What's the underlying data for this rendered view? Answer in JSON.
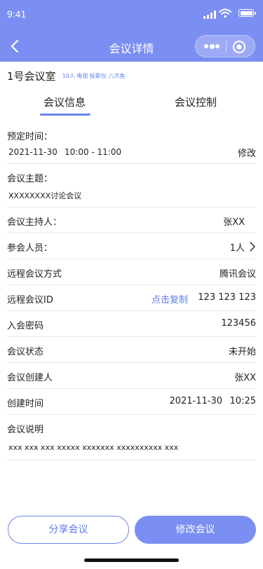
{
  "status_bar": {
    "time": "9:41"
  },
  "navbar": {
    "title": "会议详情"
  },
  "room": {
    "name": "1号会议室",
    "tags": "10人 电视 投影仪 八爪鱼"
  },
  "tabs": [
    {
      "label": "会议信息",
      "active": true
    },
    {
      "label": "会议控制",
      "active": false
    }
  ],
  "schedule": {
    "label": "预定时间：",
    "date": "2021-11-30",
    "time_range": "10:00 - 11:00",
    "edit_label": "修改"
  },
  "topic": {
    "label": "会议主题：",
    "value": "XXXXXXXX讨论会议"
  },
  "host": {
    "label": "会议主持人：",
    "value": "张XX"
  },
  "participants": {
    "label": "参会人员：",
    "value": "1人"
  },
  "remote_method": {
    "label": "远程会议方式",
    "value": "腾讯会议"
  },
  "remote_id": {
    "label": "远程会议ID",
    "copy_label": "点击复制",
    "value": "123 123 123"
  },
  "password": {
    "label": "入会密码",
    "value": "123456"
  },
  "meeting_status": {
    "label": "会议状态",
    "value": "未开始"
  },
  "creator": {
    "label": "会议创建人",
    "value": "张XX"
  },
  "created_time": {
    "label": "创建时间",
    "date": "2021-11-30",
    "time": "10:25"
  },
  "description": {
    "label": "会议说明",
    "value": "xxx xxx xxx xxxxx xxxxxxx xxxxxxxxxx xxx"
  },
  "actions": {
    "share_label": "分享会议",
    "edit_label": "修改会议"
  },
  "colors": {
    "primary": "#7b8ef2",
    "link": "#5b7cf0",
    "divider": "#e6e6e6"
  }
}
